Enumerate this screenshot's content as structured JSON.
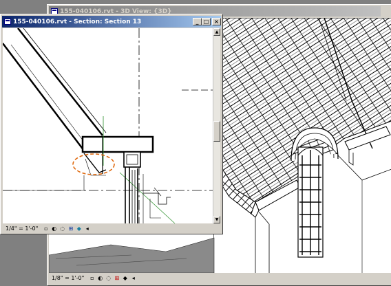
{
  "view3d": {
    "title": "155-040106.rvt - 3D View: {3D}",
    "scale": "1/8\" = 1'-0\""
  },
  "section": {
    "title": "155-040106.rvt - Section: Section 13",
    "scale": "1/4\" = 1'-0\"",
    "minimize_glyph": "_",
    "maximize_glyph": "□",
    "close_glyph": "×"
  },
  "statusbar_icons": [
    "detail-level-icon",
    "visual-style-icon",
    "sun-path-icon",
    "shadows-icon",
    "crop-region-icon",
    "hide-isolate-icon",
    "scroll-left-icon"
  ],
  "colors": {
    "title_active": "#0a246a",
    "title_inactive": "#808080",
    "annotation_circle": "#e06a10",
    "chrome": "#d4d0c8"
  }
}
